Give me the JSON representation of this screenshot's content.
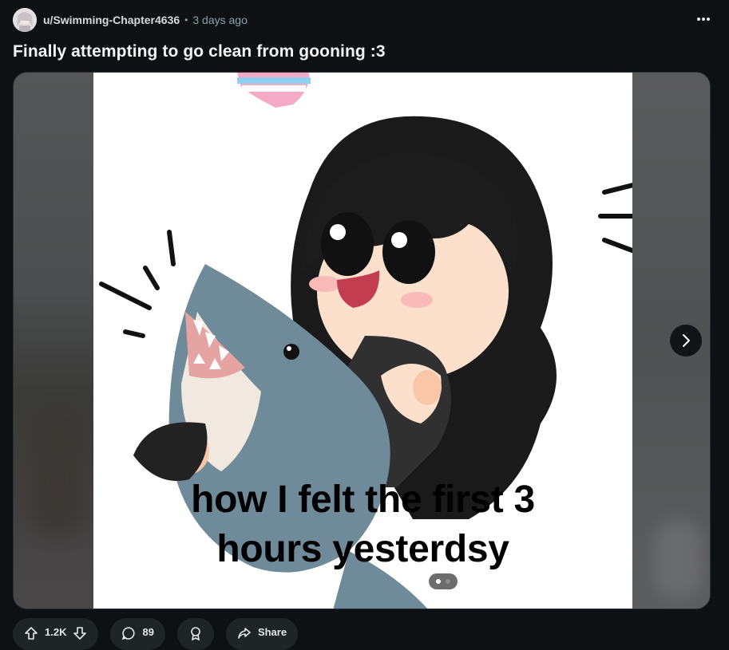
{
  "post": {
    "author": "u/Swimming-Chapter4636",
    "separator": "•",
    "time_ago": "3 days ago",
    "title": "Finally attempting to go clean from gooning :3",
    "more_icon": "ellipsis-icon"
  },
  "media": {
    "caption_line1": "how I felt the first 3",
    "caption_line2": "hours yesterdsy",
    "current_index": 1,
    "total_images": 2,
    "next_icon": "chevron-right-icon"
  },
  "actions": {
    "upvotes": "1.2K",
    "comments": "89",
    "share": "Share"
  },
  "colors": {
    "background": "#0e1113",
    "pill": "#1f2426",
    "meta_text": "#8ba2ad"
  }
}
